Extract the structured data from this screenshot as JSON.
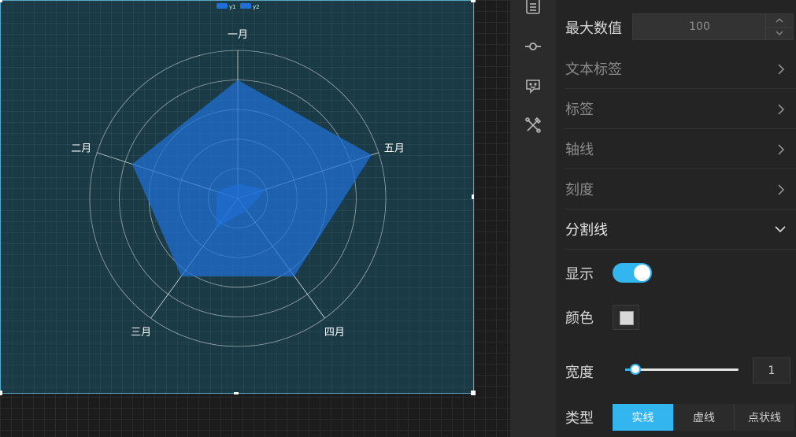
{
  "chart_data": {
    "type": "radar",
    "indicators": [
      "一月",
      "五月",
      "四月",
      "三月",
      "二月"
    ],
    "max": 100,
    "series": [
      {
        "name": "y1",
        "values": [
          80,
          95,
          65,
          65,
          75
        ]
      },
      {
        "name": "y2",
        "values": [
          10,
          20,
          10,
          25,
          15
        ]
      }
    ],
    "legend": [
      "y1",
      "y2"
    ],
    "legend_position": "top-center",
    "split_number": 5,
    "colors": {
      "y1": "#1e70d8",
      "y2": "#1e70d8",
      "axis": "#ffffff",
      "label": "#ffffff"
    }
  },
  "icon_strip": {
    "icons": [
      "list-icon",
      "commit-icon",
      "chat-icon",
      "tools-icon"
    ]
  },
  "panel": {
    "max_value_label": "最大数值",
    "max_value": "100",
    "sections": [
      {
        "label": "文本标签",
        "expanded": false
      },
      {
        "label": "标签",
        "expanded": false
      },
      {
        "label": "轴线",
        "expanded": false
      },
      {
        "label": "刻度",
        "expanded": false
      },
      {
        "label": "分割线",
        "expanded": true
      }
    ],
    "show_label": "显示",
    "show_enabled": true,
    "color_label": "颜色",
    "color_value": "#d9d9d9",
    "width_label": "宽度",
    "width_value": "1",
    "type_label": "类型",
    "type_options": [
      "实线",
      "虚线",
      "点状线"
    ],
    "type_selected": "实线",
    "accent": "#33b5f0"
  }
}
